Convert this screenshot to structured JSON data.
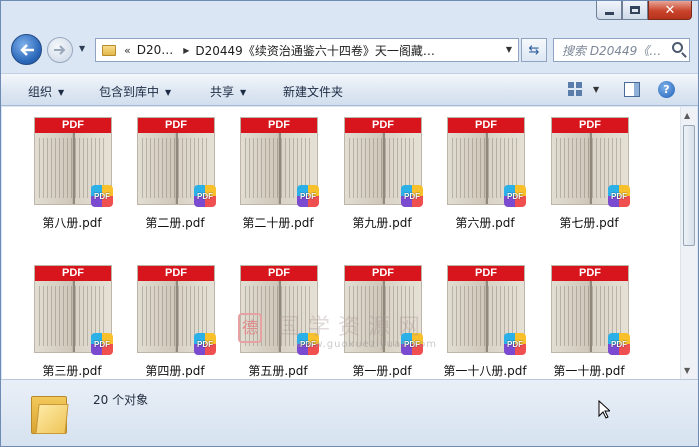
{
  "window": {
    "caption": {
      "minimize": "minimize",
      "maximize": "maximize",
      "close": "close"
    }
  },
  "nav": {
    "address": {
      "chevron": "«",
      "segments": [
        "D20…",
        "D20449《续资治通鉴六十四卷》天一阁藏…"
      ]
    },
    "search_placeholder": "搜索 D20449《…"
  },
  "toolbar": {
    "organize": "组织",
    "include_in_library": "包含到库中",
    "share": "共享",
    "new_folder": "新建文件夹"
  },
  "files": [
    {
      "name": "第八册.pdf"
    },
    {
      "name": "第二册.pdf"
    },
    {
      "name": "第二十册.pdf"
    },
    {
      "name": "第九册.pdf"
    },
    {
      "name": "第六册.pdf"
    },
    {
      "name": "第七册.pdf"
    },
    {
      "name": "第三册.pdf"
    },
    {
      "name": "第四册.pdf"
    },
    {
      "name": "第五册.pdf"
    },
    {
      "name": "第一册.pdf"
    },
    {
      "name": "第一十八册.pdf"
    },
    {
      "name": "第一十册.pdf"
    }
  ],
  "thumb_band": "PDF",
  "badge_text": "PDF",
  "watermark": {
    "seal": "德",
    "cn": "国学资源网",
    "url": "www.guoxueziyuan.com"
  },
  "status": {
    "count_text": "20 个对象"
  },
  "icons": [
    "back-arrow-icon",
    "forward-arrow-icon",
    "folder-icon",
    "refresh-icon",
    "search-icon",
    "view-options-icon",
    "preview-pane-icon",
    "help-icon",
    "pdf-badge-icon"
  ]
}
